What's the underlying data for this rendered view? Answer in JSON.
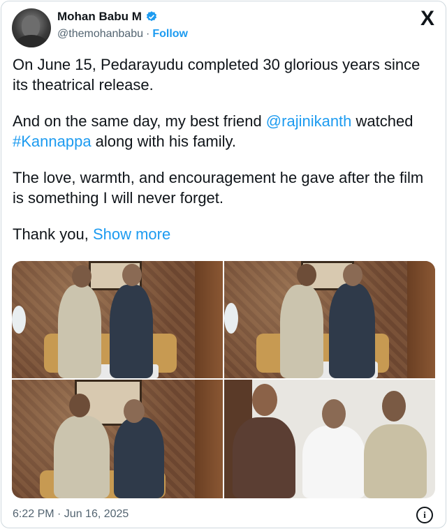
{
  "author": {
    "name": "Mohan Babu M",
    "handle": "@themohanbabu",
    "separator": "·",
    "follow_label": "Follow",
    "verified_icon": "verified-badge-icon",
    "avatar_alt": "avatar"
  },
  "brand": {
    "logo": "X"
  },
  "tweet": {
    "p1": "On June 15, Pedarayudu completed 30 glorious years since its theatrical release.",
    "p2_before": "And on the same day, my best friend ",
    "p2_mention": "@rajinikanth",
    "p2_mid": " watched ",
    "p2_hashtag": "#Kannappa",
    "p2_after": " along with his family.",
    "p3": "The love, warmth, and encouragement he gave after the film is something I will never forget.",
    "p4_before": "Thank you, ",
    "show_more": "Show more"
  },
  "media": {
    "count": 4
  },
  "footer": {
    "timestamp": "6:22 PM · Jun 16, 2025",
    "info_icon": "info-icon",
    "info_glyph": "i"
  },
  "colors": {
    "link": "#1d9bf0",
    "text": "#0f1419",
    "muted": "#536471",
    "border": "#cfd9de"
  }
}
